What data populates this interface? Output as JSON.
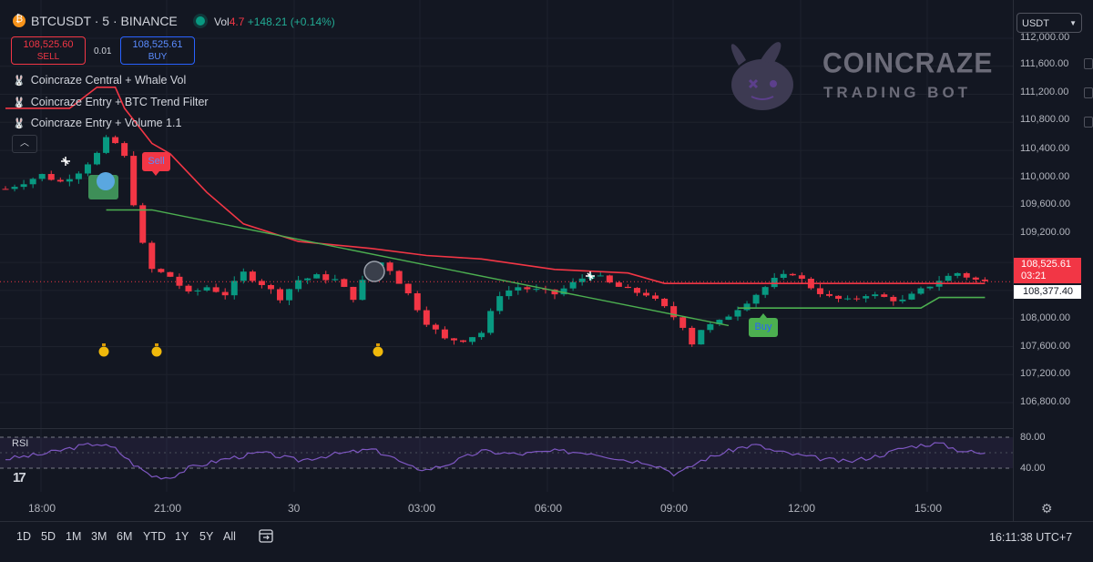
{
  "header": {
    "title": "BTCUSDT · 5 · BINANCE",
    "vol_label": "Vol",
    "vol_value": "4.7",
    "change": "+148.21 (+0.14%)",
    "sell_price": "108,525.60",
    "sell_label": "SELL",
    "spread": "0.01",
    "buy_price": "108,525.61",
    "buy_label": "BUY",
    "currency": "USDT"
  },
  "indicators": [
    {
      "label": "Coincraze Central + Whale Vol"
    },
    {
      "label": "Coincraze Entry + BTC Trend Filter"
    },
    {
      "label": "Coincraze Entry + Volume 1.1"
    }
  ],
  "logo": {
    "title": "COINCRAZE",
    "subtitle": "TRADING BOT"
  },
  "signals": {
    "sell": "Sell",
    "buy": "Buy"
  },
  "price_axis": [
    "112,000.00",
    "111,600.00",
    "111,200.00",
    "110,800.00",
    "110,400.00",
    "110,000.00",
    "109,600.00",
    "109,200.00",
    "108,000.00",
    "107,600.00",
    "107,200.00",
    "106,800.00"
  ],
  "current_price": {
    "value": "108,525.61",
    "countdown": "03:21",
    "other": "108,377.40"
  },
  "rsi": {
    "label": "RSI",
    "upper": "80.00",
    "lower": "40.00"
  },
  "time_axis": [
    "18:00",
    "21:00",
    "30",
    "03:00",
    "06:00",
    "09:00",
    "12:00",
    "15:00"
  ],
  "bottom_bar": {
    "ranges": [
      "1D",
      "5D",
      "1M",
      "3M",
      "6M",
      "YTD",
      "1Y",
      "5Y",
      "All"
    ],
    "clock": "16:11:38 UTC+7"
  },
  "colors": {
    "up": "#089981",
    "down": "#f23645",
    "bg": "#131722",
    "trend_red": "#f23645",
    "trend_green": "#4caf50",
    "rsi": "#7e57c2"
  },
  "chart_data": {
    "type": "candlestick",
    "interval_minutes": 5,
    "ylim": [
      106600,
      112000
    ],
    "close_series": [
      [
        0,
        109850
      ],
      [
        2,
        109950
      ],
      [
        4,
        110050
      ],
      [
        6,
        109950
      ],
      [
        8,
        110100
      ],
      [
        10,
        110350
      ],
      [
        11,
        110550
      ],
      [
        12,
        110500
      ],
      [
        13,
        110300
      ],
      [
        14,
        109650
      ],
      [
        15,
        109050
      ],
      [
        16,
        108700
      ],
      [
        18,
        108600
      ],
      [
        20,
        108350
      ],
      [
        22,
        108450
      ],
      [
        24,
        108350
      ],
      [
        26,
        108650
      ],
      [
        28,
        108500
      ],
      [
        30,
        108300
      ],
      [
        32,
        108550
      ],
      [
        34,
        108600
      ],
      [
        36,
        108550
      ],
      [
        38,
        108300
      ],
      [
        40,
        108750
      ],
      [
        41,
        108800
      ],
      [
        42,
        108700
      ],
      [
        44,
        108350
      ],
      [
        46,
        107950
      ],
      [
        48,
        107700
      ],
      [
        50,
        107700
      ],
      [
        52,
        107800
      ],
      [
        54,
        108350
      ],
      [
        56,
        108450
      ],
      [
        58,
        108400
      ],
      [
        60,
        108350
      ],
      [
        62,
        108500
      ],
      [
        64,
        108650
      ],
      [
        66,
        108500
      ],
      [
        68,
        108400
      ],
      [
        70,
        108350
      ],
      [
        72,
        108150
      ],
      [
        74,
        107900
      ],
      [
        75,
        107650
      ],
      [
        76,
        107850
      ],
      [
        78,
        107950
      ],
      [
        80,
        108150
      ],
      [
        82,
        108350
      ],
      [
        84,
        108550
      ],
      [
        86,
        108650
      ],
      [
        88,
        108450
      ],
      [
        90,
        108300
      ],
      [
        92,
        108250
      ],
      [
        94,
        108350
      ],
      [
        96,
        108300
      ],
      [
        98,
        108250
      ],
      [
        100,
        108400
      ],
      [
        102,
        108550
      ],
      [
        104,
        108650
      ],
      [
        106,
        108550
      ],
      [
        107,
        108520
      ]
    ],
    "resistance_line": [
      [
        0,
        111000
      ],
      [
        7,
        111000
      ],
      [
        10,
        111300
      ],
      [
        12,
        111300
      ],
      [
        13,
        111000
      ],
      [
        16,
        110500
      ],
      [
        18,
        110350
      ],
      [
        22,
        109800
      ],
      [
        26,
        109350
      ],
      [
        32,
        109100
      ],
      [
        40,
        109000
      ],
      [
        46,
        108900
      ],
      [
        52,
        108850
      ],
      [
        60,
        108700
      ],
      [
        68,
        108650
      ],
      [
        72,
        108500
      ],
      [
        107,
        108500
      ]
    ],
    "trend_line": [
      [
        11,
        109550
      ],
      [
        16,
        109550
      ],
      [
        56,
        108500
      ],
      [
        79,
        107900
      ]
    ],
    "support_line": [
      [
        80,
        108150
      ],
      [
        100,
        108150
      ],
      [
        102,
        108300
      ],
      [
        107,
        108300
      ]
    ],
    "rsi_series": [
      [
        0,
        52
      ],
      [
        4,
        58
      ],
      [
        8,
        68
      ],
      [
        10,
        72
      ],
      [
        12,
        65
      ],
      [
        14,
        45
      ],
      [
        16,
        30
      ],
      [
        18,
        28
      ],
      [
        20,
        40
      ],
      [
        24,
        52
      ],
      [
        28,
        60
      ],
      [
        32,
        50
      ],
      [
        36,
        58
      ],
      [
        40,
        64
      ],
      [
        42,
        56
      ],
      [
        44,
        42
      ],
      [
        46,
        38
      ],
      [
        48,
        44
      ],
      [
        52,
        62
      ],
      [
        56,
        58
      ],
      [
        60,
        62
      ],
      [
        64,
        60
      ],
      [
        68,
        50
      ],
      [
        70,
        48
      ],
      [
        72,
        40
      ],
      [
        73,
        33
      ],
      [
        74,
        36
      ],
      [
        76,
        50
      ],
      [
        80,
        66
      ],
      [
        82,
        70
      ],
      [
        84,
        62
      ],
      [
        88,
        54
      ],
      [
        92,
        48
      ],
      [
        96,
        58
      ],
      [
        98,
        66
      ],
      [
        100,
        70
      ],
      [
        102,
        72
      ],
      [
        104,
        64
      ],
      [
        107,
        58
      ]
    ]
  }
}
